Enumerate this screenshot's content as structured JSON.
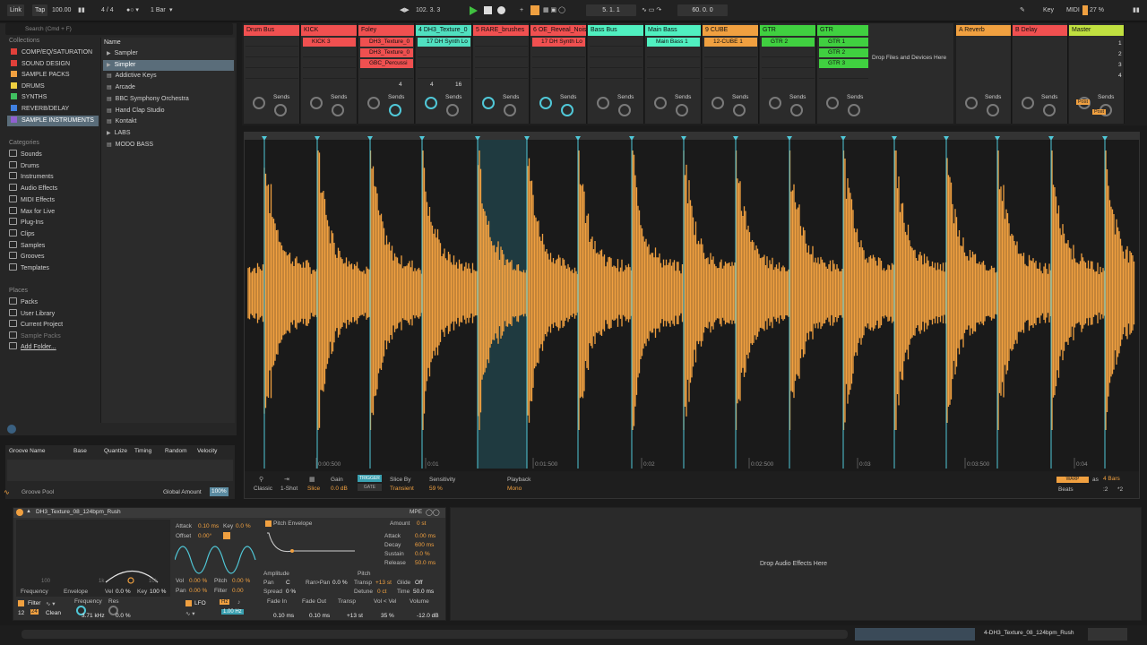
{
  "topbar": {
    "link": "Link",
    "tap": "Tap",
    "tempo": "100.00",
    "signature": "4 / 4",
    "quantize": "1 Bar",
    "position": "102.  3.  3",
    "loop_start": "5.  1.  1",
    "loop_length": "60.  0.  0",
    "key": "Key",
    "midi": "MIDI",
    "cpu": "27 %"
  },
  "browser": {
    "search_placeholder": "Search (Cmd + F)",
    "collections_title": "Collections",
    "collections": [
      {
        "label": "COMP/EQ/SATURATION",
        "color": "#e0403a"
      },
      {
        "label": "SOUND DESIGN",
        "color": "#e0403a"
      },
      {
        "label": "SAMPLE PACKS",
        "color": "#f0a040"
      },
      {
        "label": "DRUMS",
        "color": "#f0d040"
      },
      {
        "label": "SYNTHS",
        "color": "#40c060"
      },
      {
        "label": "REVERB/DELAY",
        "color": "#4080e0"
      },
      {
        "label": "SAMPLE INSTRUMENTS",
        "color": "#9060d0"
      }
    ],
    "categories_title": "Categories",
    "categories": [
      "Sounds",
      "Drums",
      "Instruments",
      "Audio Effects",
      "MIDI Effects",
      "Max for Live",
      "Plug-Ins",
      "Clips",
      "Samples",
      "Grooves",
      "Templates"
    ],
    "places_title": "Places",
    "places": [
      "Packs",
      "User Library",
      "Current Project",
      "Sample Packs",
      "Add Folder..."
    ],
    "name_header": "Name",
    "names": [
      "Sampler",
      "Simpler",
      "Addictive Keys",
      "Arcade",
      "BBC Symphony Orchestra",
      "Hand Clap Studio",
      "Kontakt",
      "LABS",
      "MODO BASS"
    ]
  },
  "groove": {
    "cols": [
      "Groove Name",
      "Base",
      "Quantize",
      "Timing",
      "Random",
      "Velocity"
    ],
    "pool": "Groove Pool",
    "global_amount_label": "Global Amount",
    "global_amount": "100%"
  },
  "session": {
    "tracks": [
      {
        "name": "Drum Bus",
        "color": "#f05050",
        "clips": [],
        "w": 63
      },
      {
        "name": "KICK",
        "color": "#f05050",
        "clips": [
          "KICK 3"
        ],
        "w": 63
      },
      {
        "name": "Foley",
        "color": "#f05050",
        "clips": [
          "DH3_Texture_0",
          "DH3_Texture_0",
          "GBC_Percussi"
        ],
        "w": 63
      },
      {
        "name": "4 DH3_Texture_0",
        "color": "#50e0c0",
        "clips": [
          "17 DH Synth Lo"
        ],
        "w": 63
      },
      {
        "name": "5 RARE_brushes",
        "color": "#f05050",
        "clips": [],
        "w": 63
      },
      {
        "name": "6 OE_Reveal_Nois",
        "color": "#f05050",
        "clips": [
          "17 DH Synth Lo"
        ],
        "w": 63
      },
      {
        "name": "Bass Bus",
        "color": "#50f0c0",
        "clips": [],
        "w": 63
      },
      {
        "name": "Main Bass",
        "color": "#50f0c0",
        "clips": [
          "Main Bass 1"
        ],
        "w": 63
      },
      {
        "name": "9 CUBE",
        "color": "#f0a040",
        "clips": [
          "12-CUBE 1"
        ],
        "w": 63
      },
      {
        "name": "GTR",
        "color": "#40d040",
        "clips": [
          "GTR 2"
        ],
        "w": 63
      },
      {
        "name": "GTR",
        "color": "#40d040",
        "clips": [
          "GTR 1",
          "GTR 2",
          "GTR 3"
        ],
        "w": 63
      }
    ],
    "drop_text": "Drop Files and Devices Here",
    "returns": [
      {
        "name": "A Reverb",
        "color": "#f0a040"
      },
      {
        "name": "B Delay",
        "color": "#f05050"
      },
      {
        "name": "Master",
        "color": "#c0e040"
      }
    ],
    "sends_label": "Sends",
    "scene_numbers": [
      "1",
      "2",
      "3",
      "4"
    ],
    "post_label": "Post",
    "foley_nums": [
      "4",
      "16"
    ]
  },
  "sample": {
    "time_labels": [
      "0:00:500",
      "0:01",
      "0:01:500",
      "0:02",
      "0:02:500",
      "0:03",
      "0:03:500",
      "0:04"
    ],
    "modes": [
      "Classic",
      "1-Shot",
      "Slice"
    ],
    "gain_label": "Gain",
    "gain": "0.0 dB",
    "trigger": "TRIGGER",
    "gate": "GATE",
    "slice_by_label": "Slice By",
    "slice_by": "Transient",
    "sensitivity_label": "Sensitivity",
    "sensitivity": "59 %",
    "playback_label": "Playback",
    "playback": "Mono",
    "warp": "WARP",
    "as": "as",
    "bars": "4 Bars",
    "beats": "Beats",
    "half": ":2",
    "double": "*2"
  },
  "device": {
    "title": "DH3_Texture_08_124bpm_Rush",
    "mpe": "MPE",
    "attack_label": "Attack",
    "attack": "0.10 ms",
    "key_label": "Key",
    "key": "0.0 %",
    "offset_label": "Offset",
    "offset": "0.00°",
    "vol_label": "Vol",
    "vol": "0.00 %",
    "pitch_label": "Pitch",
    "pitch": "0.00 %",
    "pan_label": "Pan",
    "pan": "0.00 %",
    "filter_label": "Filter",
    "filter": "0.00",
    "freq_label": "Frequency",
    "envelope_label": "Envelope",
    "vel_label": "Vel",
    "vel": "0.0 %",
    "keytrack_label": "Key",
    "keytrack": "100 %",
    "filter_section": "Filter",
    "filter_slope": "12",
    "filter_slope2": "24",
    "filter_type": "Clean",
    "frequency_label": "Frequency",
    "frequency": "3.71 kHz",
    "res_label": "Res",
    "res": "0.0 %",
    "lfo_label": "LFO",
    "lfo_hz": "Hz",
    "lfo_rate": "1.00 Hz",
    "pitch_env": "Pitch Envelope",
    "amount_label": "Amount",
    "amount": "0 st",
    "env_attack_label": "Attack",
    "env_attack": "0.00 ms",
    "decay_label": "Decay",
    "decay": "600 ms",
    "sustain_label": "Sustain",
    "sustain": "0.0 %",
    "release_label": "Release",
    "release": "50.0 ms",
    "amplitude_label": "Amplitude",
    "pitch_section": "Pitch",
    "amp_pan_label": "Pan",
    "amp_pan": "C",
    "ranpan_label": "Ran>Pan",
    "ranpan": "0.0 %",
    "spread_label": "Spread",
    "spread": "0 %",
    "transp_label": "Transp",
    "transp": "+13 st",
    "glide_label": "Glide",
    "glide": "Off",
    "detune_label": "Detune",
    "detune": "0 ct",
    "time_label": "Time",
    "time": "50.0 ms",
    "fadein_label": "Fade In",
    "fadein": "0.10 ms",
    "fadeout_label": "Fade Out",
    "fadeout": "0.10 ms",
    "transp2_label": "Transp",
    "transp2": "+13 st",
    "volvel_label": "Vol < Vel",
    "volvel": "35 %",
    "volume_label": "Volume",
    "volume": "-12.0 dB",
    "axis_100": "100",
    "axis_1k": "1k",
    "axis_10k": "10k"
  },
  "fx": {
    "drop_text": "Drop Audio Effects Here"
  },
  "bottom": {
    "clip_name": "4-DH3_Texture_08_124bpm_Rush"
  },
  "colors": {
    "waveform": "#f0a040",
    "slice_marker": "#50c8d8",
    "selection": "#1f3a40"
  }
}
